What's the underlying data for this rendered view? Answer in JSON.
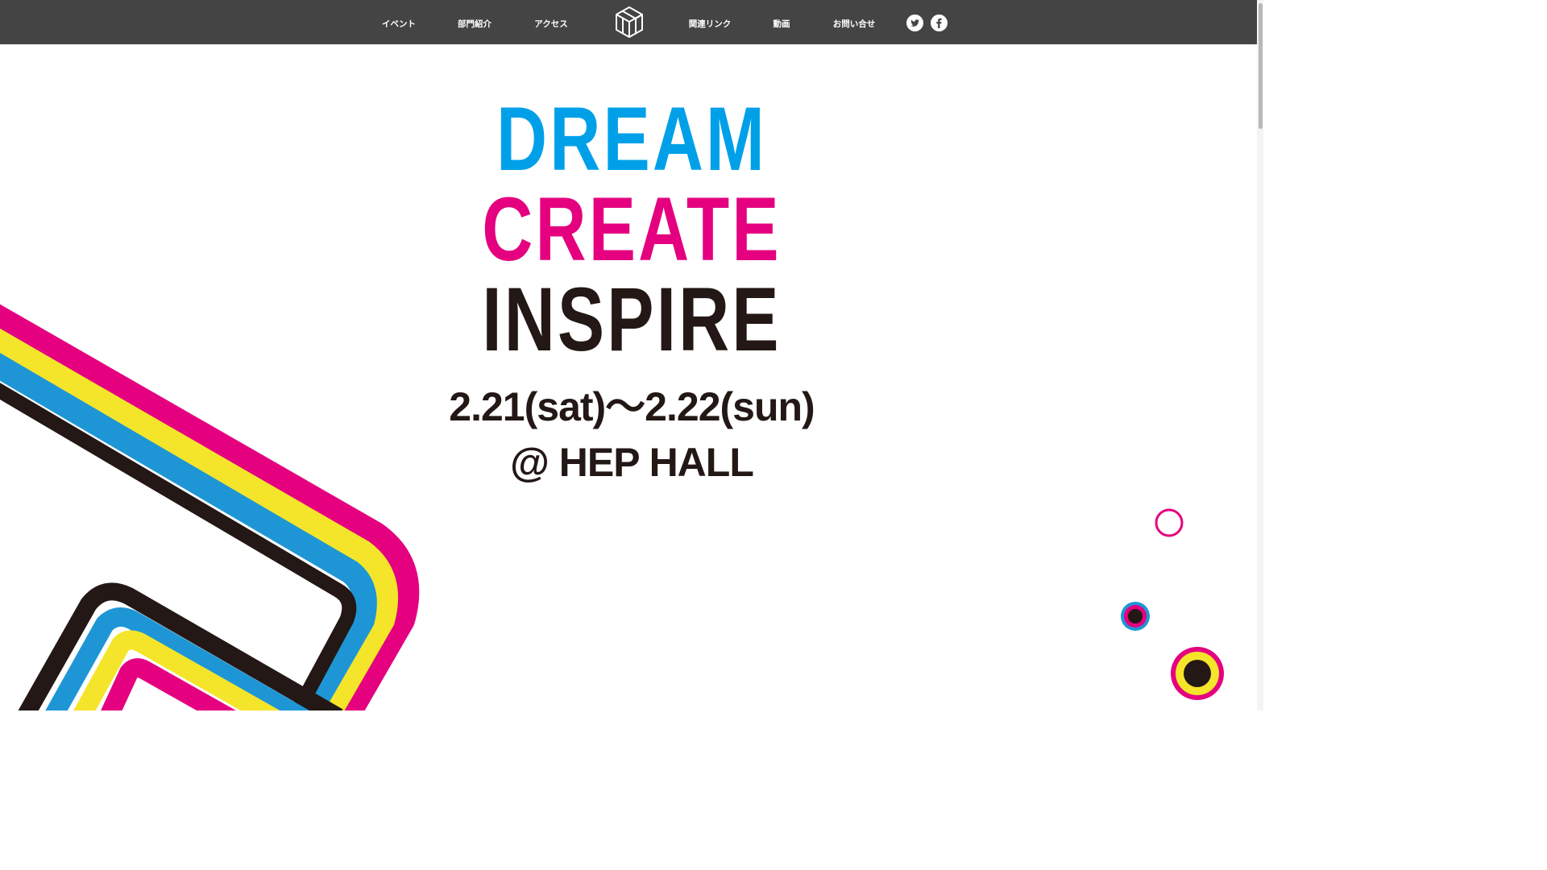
{
  "nav": {
    "items_left": [
      "イベント",
      "部門紹介",
      "アクセス"
    ],
    "items_right": [
      "関連リンク",
      "動画",
      "お問い合せ"
    ],
    "logo": "cube-logo-icon",
    "social": [
      "twitter-icon",
      "facebook-icon"
    ],
    "background": "#444444"
  },
  "hero": {
    "line1": "DREAM",
    "line2": "CREATE",
    "line3": "INSPIRE",
    "date": "2.21(sat)～2.22(sun)",
    "venue": "@ HEP HALL"
  },
  "colors": {
    "cyan": "#00a0e9",
    "magenta": "#e4007f",
    "yellow": "#f4e52a",
    "black": "#231815"
  }
}
